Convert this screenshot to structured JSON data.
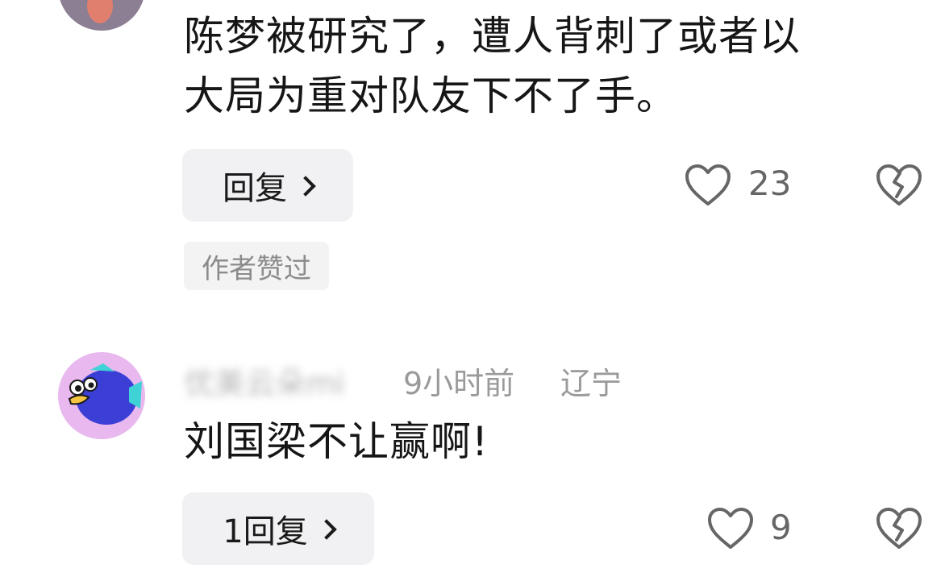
{
  "comments": [
    {
      "text_line1": "陈梦被研究了，遭人背刺了或者以",
      "text_line2": "大局为重对队友下不了手。",
      "reply_label": "回复",
      "like_count": "23",
      "author_badge": "作者赞过"
    },
    {
      "username": "优美云朵mi",
      "time": "9小时前",
      "location": "辽宁",
      "text": "刘国梁不让赢啊!",
      "reply_label": "1回复",
      "like_count": "9"
    }
  ],
  "icons": {
    "like": "heart-outline-icon",
    "dislike": "broken-heart-icon",
    "chevron": "chevron-right-icon"
  },
  "colors": {
    "text": "#161616",
    "meta": "#9a9a9a",
    "button_bg": "#f1f1f3",
    "avatar2_bg": "#e8b8ee",
    "avatar2_fish": "#3b3fd6"
  }
}
